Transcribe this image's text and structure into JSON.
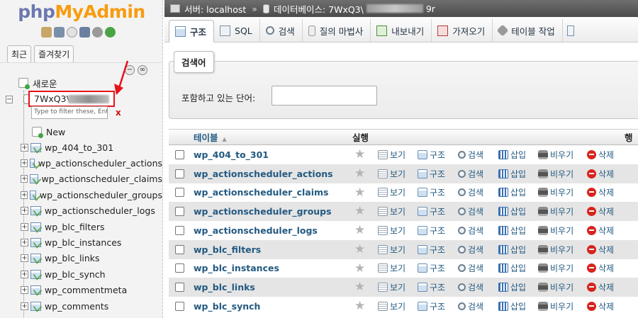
{
  "nav": {
    "logo_php": "php",
    "logo_myadmin": "MyAdmin",
    "tabs": [
      "최근",
      "즐겨찾기"
    ],
    "new_label": "새로운",
    "db_name": "7WxQ3V",
    "filter_placeholder": "Type to filter these, Ente",
    "filter_clear": "x",
    "new_table_label": "New",
    "tables": [
      "wp_404_to_301",
      "wp_actionscheduler_actions",
      "wp_actionscheduler_claims",
      "wp_actionscheduler_groups",
      "wp_actionscheduler_logs",
      "wp_blc_filters",
      "wp_blc_instances",
      "wp_blc_links",
      "wp_blc_synch",
      "wp_commentmeta",
      "wp_comments"
    ]
  },
  "topbar": {
    "server_label": "서버: localhost",
    "db_label": "데이터베이스: 7WxQ3\\",
    "db_suffix": "9r",
    "separator": "»"
  },
  "tabs": [
    {
      "label": "구조",
      "icon": "structure-icon",
      "active": true
    },
    {
      "label": "SQL",
      "icon": "sql-icon"
    },
    {
      "label": "검색",
      "icon": "search-icon"
    },
    {
      "label": "질의 마법사",
      "icon": "query-icon"
    },
    {
      "label": "내보내기",
      "icon": "export-icon"
    },
    {
      "label": "가져오기",
      "icon": "import-icon"
    },
    {
      "label": "테이블 작업",
      "icon": "operations-icon"
    }
  ],
  "search": {
    "legend": "검색어",
    "label": "포함하고 있는 단어:",
    "value": ""
  },
  "table": {
    "col_table": "테이블",
    "col_action": "실행",
    "col_rows": "행",
    "actions": [
      "보기",
      "구조",
      "검색",
      "삽입",
      "비우기",
      "삭제"
    ],
    "rows": [
      "wp_404_to_301",
      "wp_actionscheduler_actions",
      "wp_actionscheduler_claims",
      "wp_actionscheduler_groups",
      "wp_actionscheduler_logs",
      "wp_blc_filters",
      "wp_blc_instances",
      "wp_blc_links",
      "wp_blc_synch"
    ]
  },
  "colors": {
    "link": "#235a81",
    "highlight": "#e8121a",
    "logo_php": "#6c78af",
    "logo_myadmin": "#f89c0e"
  }
}
